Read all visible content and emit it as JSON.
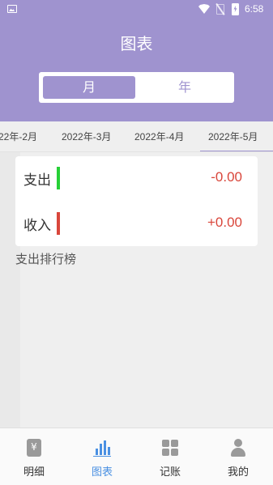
{
  "status_bar": {
    "time": "6:58",
    "icons": [
      "image-notification-icon",
      "wifi-icon",
      "no-sim-icon",
      "battery-charging-icon"
    ]
  },
  "header": {
    "title": "图表",
    "segment": {
      "month": "月",
      "year": "年",
      "selected": "月"
    }
  },
  "month_tabs": {
    "items": [
      "22年-2月",
      "2022年-3月",
      "2022年-4月",
      "2022年-5月"
    ],
    "active_index": 3
  },
  "summary": {
    "expense_label": "支出",
    "expense_amount": "-0.00",
    "expense_color": "#27d037",
    "income_label": "收入",
    "income_amount": "+0.00",
    "income_color": "#d9463b",
    "amount_color": "#d9463b"
  },
  "ranking": {
    "title": "支出排行榜"
  },
  "bottom_nav": {
    "items": [
      {
        "label": "明细",
        "icon": "detail-icon"
      },
      {
        "label": "图表",
        "icon": "chart-icon"
      },
      {
        "label": "记账",
        "icon": "grid-icon"
      },
      {
        "label": "我的",
        "icon": "user-icon"
      }
    ],
    "active_index": 1,
    "accent_color": "#4a90e2"
  },
  "theme": {
    "primary": "#9f93cf"
  }
}
